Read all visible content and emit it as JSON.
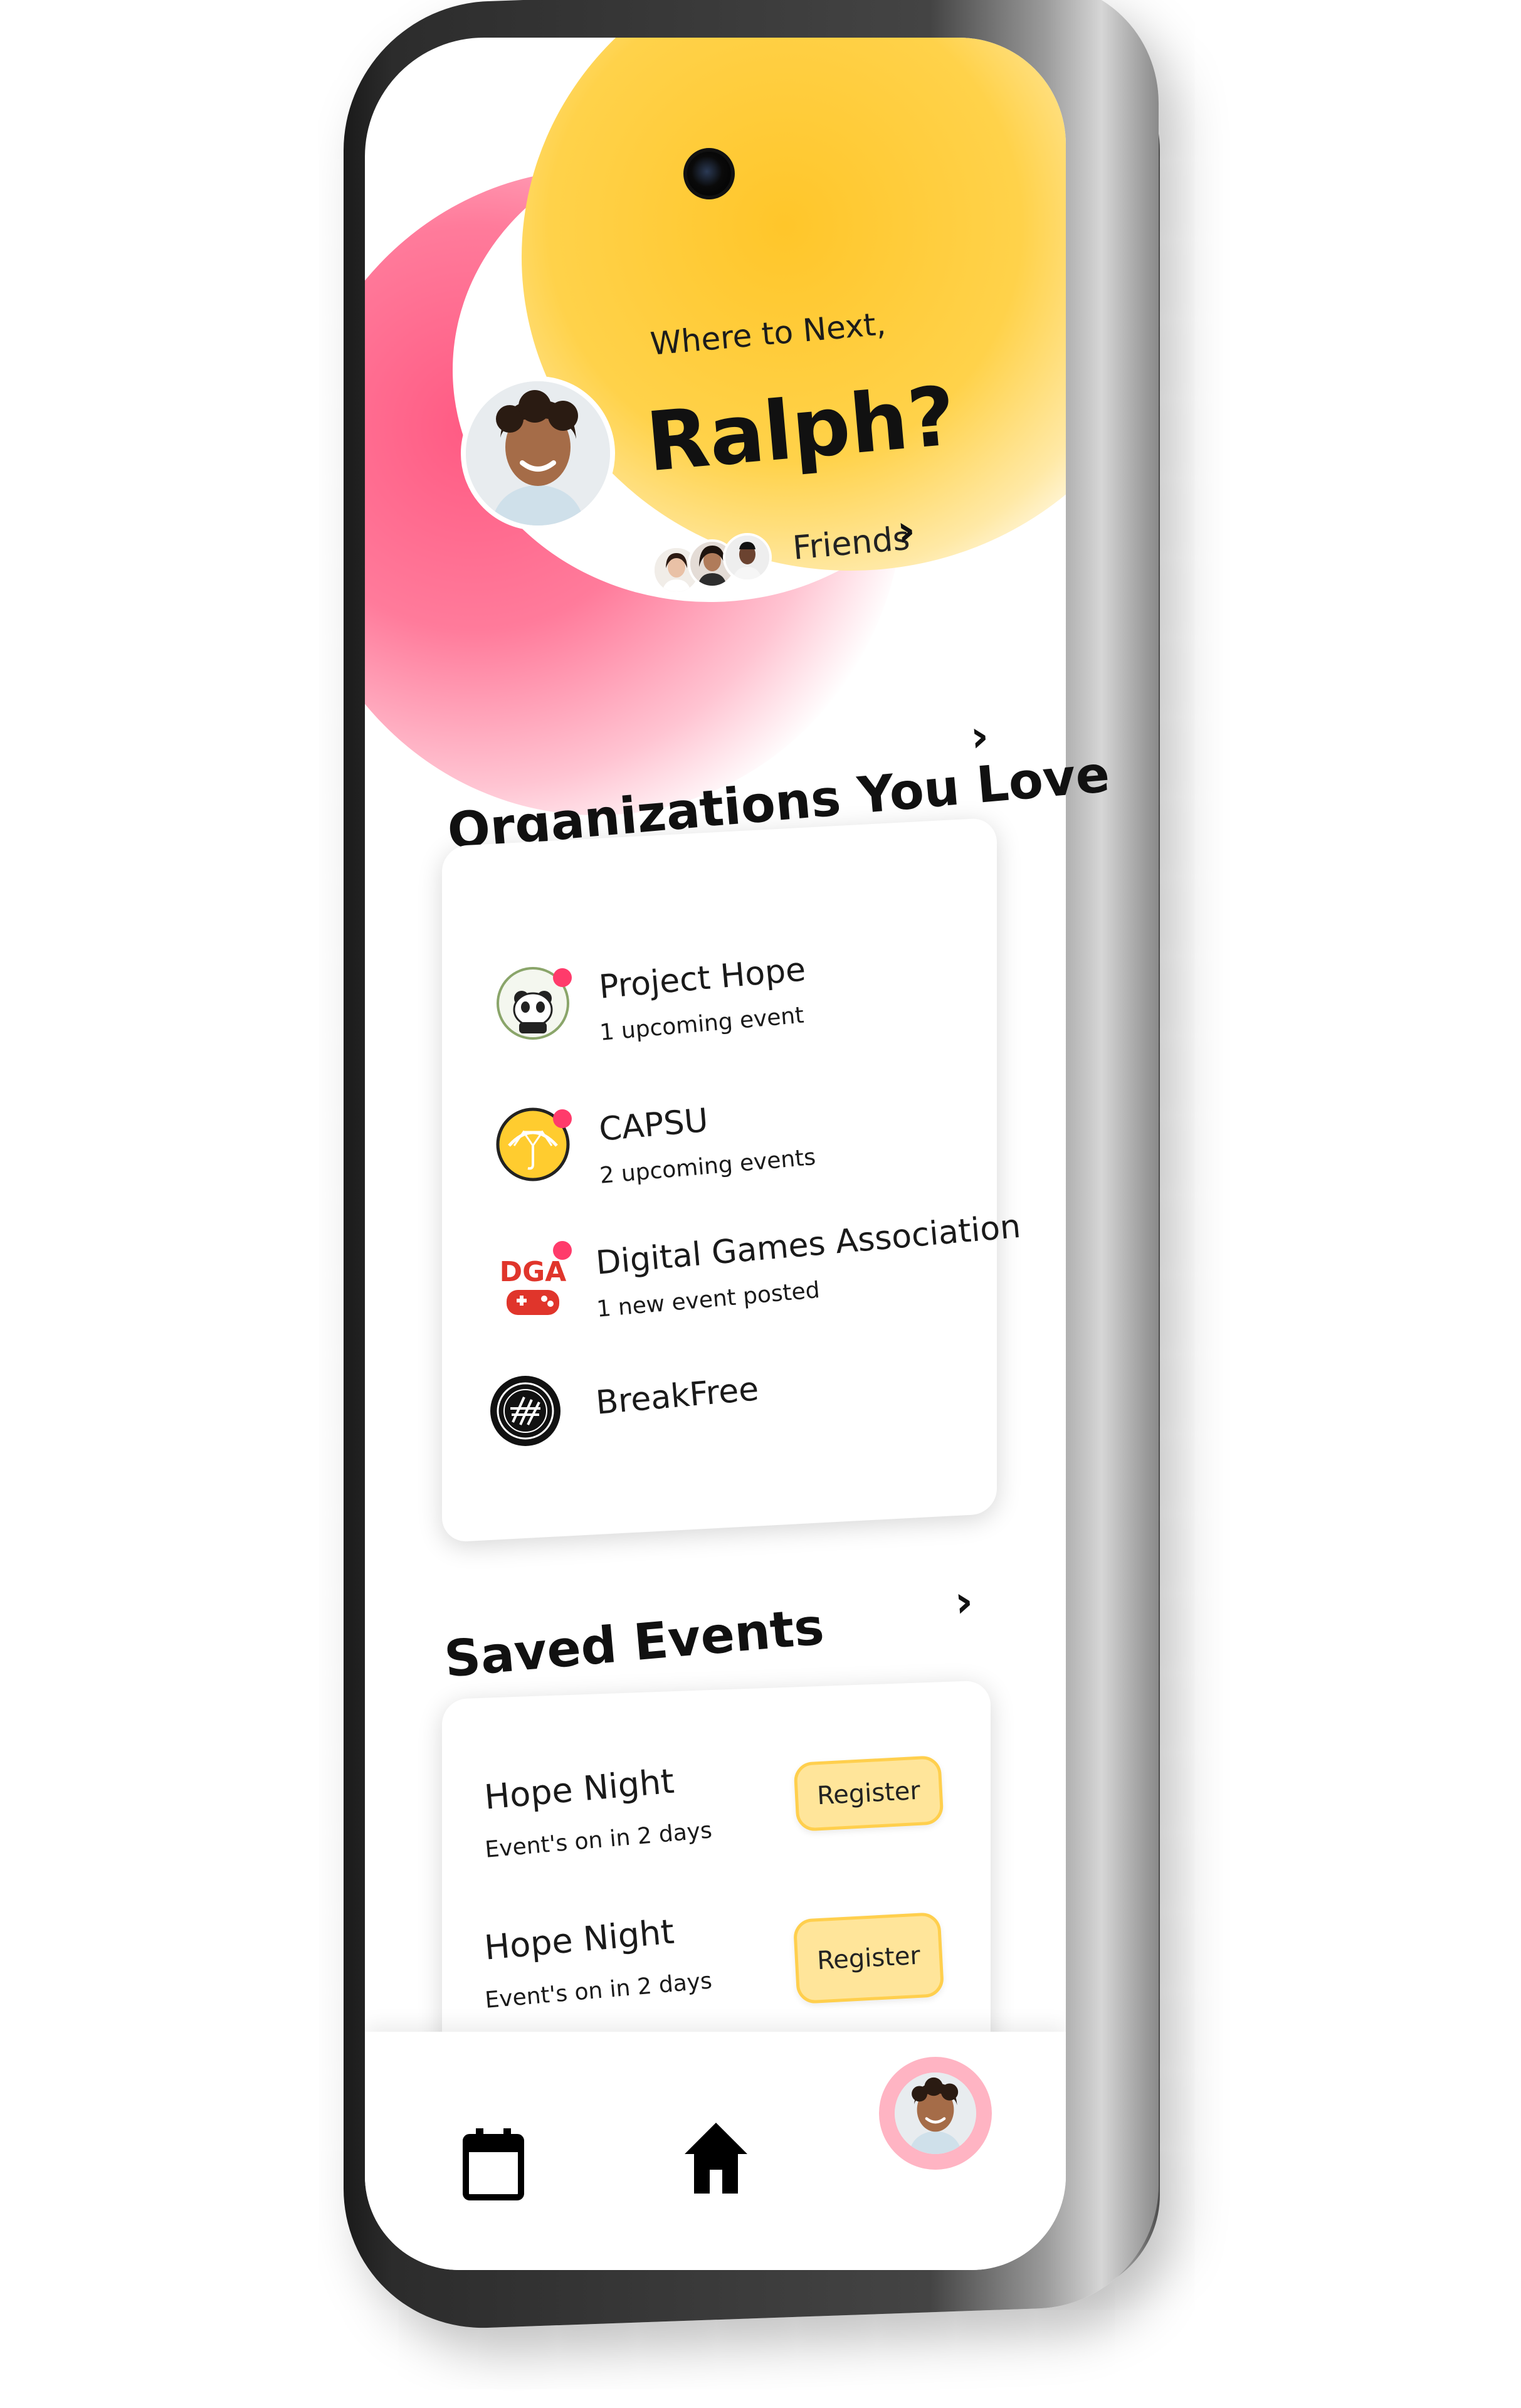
{
  "header": {
    "greeting": "Where to Next,",
    "user_name": "Ralph?",
    "friends_label": "Friends"
  },
  "organizations": {
    "title": "Organizations You Love",
    "items": [
      {
        "name": "Project Hope",
        "subtitle": "1 upcoming event",
        "has_notification": true
      },
      {
        "name": "CAPSU",
        "subtitle": "2 upcoming events",
        "has_notification": true
      },
      {
        "name": "Digital Games Association",
        "subtitle": "1 new event posted",
        "has_notification": true
      },
      {
        "name": "BreakFree",
        "subtitle": "",
        "has_notification": false
      }
    ]
  },
  "saved_events": {
    "title": "Saved Events",
    "items": [
      {
        "name": "Hope Night",
        "subtitle": "Event's on in 2 days",
        "button": "Register"
      },
      {
        "name": "Hope Night",
        "subtitle": "Event's on in 2 days",
        "button": "Register"
      }
    ]
  },
  "nav": {
    "items": [
      "calendar-icon",
      "home-icon",
      "profile-avatar"
    ]
  },
  "colors": {
    "pink": "#ff5a83",
    "yellow": "#ffc62a",
    "register_fill": "#ffe59a",
    "register_border": "#ffcf4d",
    "notification": "#ff3b6b"
  }
}
